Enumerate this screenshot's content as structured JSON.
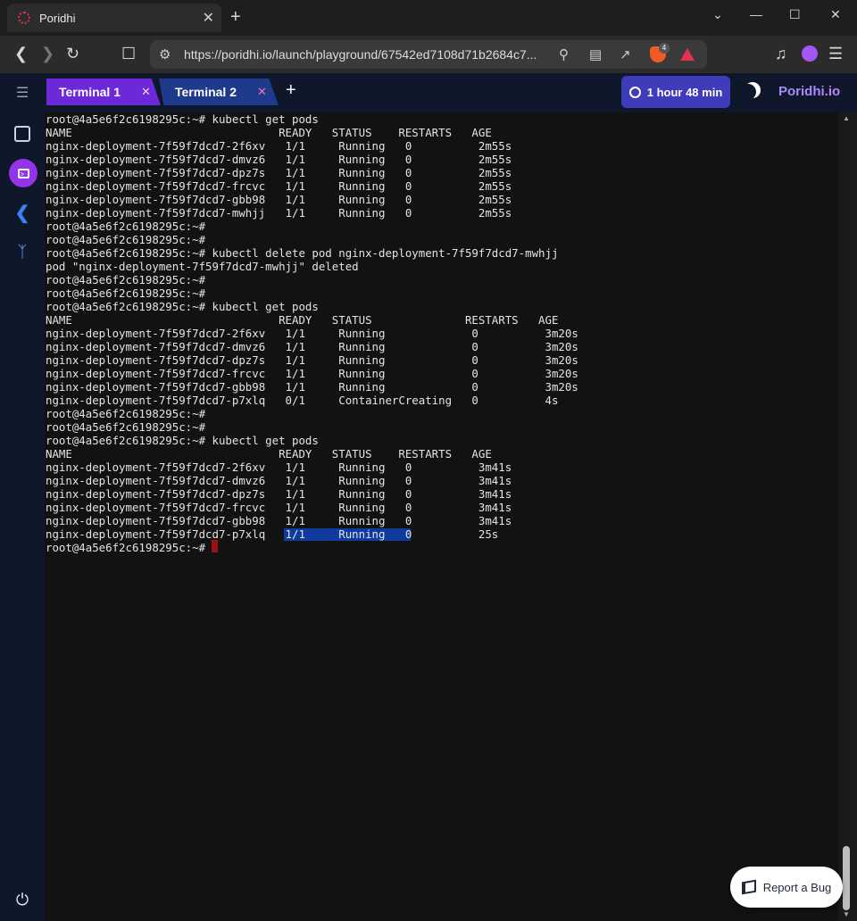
{
  "browser": {
    "tab_title": "Poridhi",
    "tab_close": "✕",
    "new_tab": "+",
    "url": "https://poridhi.io/launch/playground/67542ed7108d71b2684c7...",
    "brave_badge": "4",
    "window_controls": {
      "minimize": "—",
      "maximize": "☐",
      "close": "✕",
      "dropdown": "⌄"
    }
  },
  "app": {
    "tabs": [
      {
        "label": "Terminal 1",
        "close": "✕"
      },
      {
        "label": "Terminal 2",
        "close": "✕"
      }
    ],
    "add_tab": "+",
    "timer": "1 hour 48 min",
    "logo_main": "Poridhi",
    "logo_io": ".io",
    "report_bug": "Report a Bug"
  },
  "terminal": {
    "lines": [
      "root@4a5e6f2c6198295c:~# kubectl get pods",
      "NAME                               READY   STATUS    RESTARTS   AGE",
      "nginx-deployment-7f59f7dcd7-2f6xv   1/1     Running   0          2m55s",
      "nginx-deployment-7f59f7dcd7-dmvz6   1/1     Running   0          2m55s",
      "nginx-deployment-7f59f7dcd7-dpz7s   1/1     Running   0          2m55s",
      "nginx-deployment-7f59f7dcd7-frcvc   1/1     Running   0          2m55s",
      "nginx-deployment-7f59f7dcd7-gbb98   1/1     Running   0          2m55s",
      "nginx-deployment-7f59f7dcd7-mwhjj   1/1     Running   0          2m55s",
      "root@4a5e6f2c6198295c:~#",
      "root@4a5e6f2c6198295c:~#",
      "root@4a5e6f2c6198295c:~# kubectl delete pod nginx-deployment-7f59f7dcd7-mwhjj",
      "pod \"nginx-deployment-7f59f7dcd7-mwhjj\" deleted",
      "root@4a5e6f2c6198295c:~#",
      "root@4a5e6f2c6198295c:~#",
      "root@4a5e6f2c6198295c:~# kubectl get pods",
      "NAME                               READY   STATUS              RESTARTS   AGE",
      "nginx-deployment-7f59f7dcd7-2f6xv   1/1     Running             0          3m20s",
      "nginx-deployment-7f59f7dcd7-dmvz6   1/1     Running             0          3m20s",
      "nginx-deployment-7f59f7dcd7-dpz7s   1/1     Running             0          3m20s",
      "nginx-deployment-7f59f7dcd7-frcvc   1/1     Running             0          3m20s",
      "nginx-deployment-7f59f7dcd7-gbb98   1/1     Running             0          3m20s",
      "nginx-deployment-7f59f7dcd7-p7xlq   0/1     ContainerCreating   0          4s",
      "root@4a5e6f2c6198295c:~#",
      "root@4a5e6f2c6198295c:~#",
      "root@4a5e6f2c6198295c:~# kubectl get pods",
      "NAME                               READY   STATUS    RESTARTS   AGE",
      "nginx-deployment-7f59f7dcd7-2f6xv   1/1     Running   0          3m41s",
      "nginx-deployment-7f59f7dcd7-dmvz6   1/1     Running   0          3m41s",
      "nginx-deployment-7f59f7dcd7-dpz7s   1/1     Running   0          3m41s",
      "nginx-deployment-7f59f7dcd7-frcvc   1/1     Running   0          3m41s",
      "nginx-deployment-7f59f7dcd7-gbb98   1/1     Running   0          3m41s",
      "nginx-deployment-7f59f7dcd7-p7xlq   1/1     Running   0          25s",
      "root@4a5e6f2c6198295c:~# "
    ]
  },
  "colors": {
    "terminal_bg": "#121212",
    "app_bg": "#0f172a",
    "active_tab": "#6d28d9",
    "inactive_tab": "#1e3a8a",
    "timer_bg": "#3f3cbb",
    "selection": "#0f3a9e",
    "cursor": "#a01010"
  },
  "icons": {
    "sidebar": [
      "notes-icon",
      "terminal-icon",
      "vscode-icon",
      "tree-icon",
      "power-icon"
    ]
  }
}
